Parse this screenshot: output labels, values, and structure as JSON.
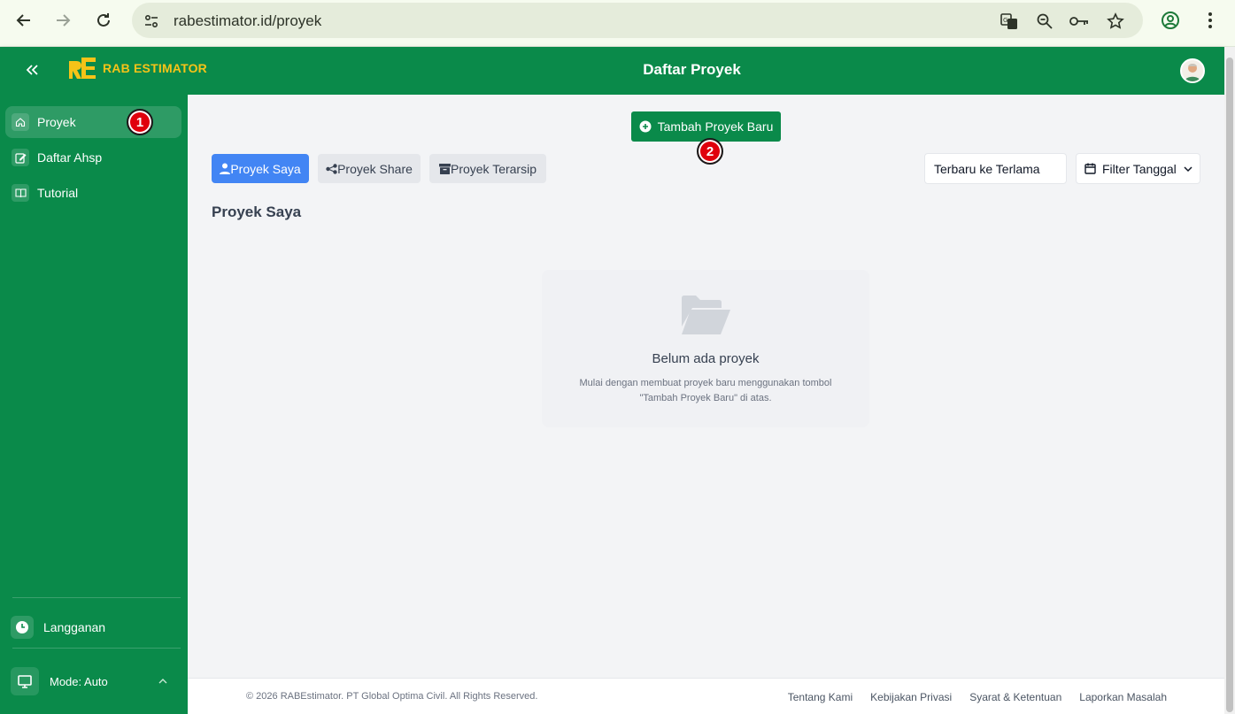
{
  "browser": {
    "url": "rabestimator.id/proyek"
  },
  "header": {
    "logo_text": "RAB ESTIMATOR",
    "title": "Daftar Proyek"
  },
  "sidebar": {
    "items": [
      {
        "label": "Proyek",
        "icon": "home-icon"
      },
      {
        "label": "Daftar Ahsp",
        "icon": "edit-icon"
      },
      {
        "label": "Tutorial",
        "icon": "book-icon"
      }
    ],
    "subscription_label": "Langganan",
    "mode_label": "Mode: Auto"
  },
  "badges": [
    "1",
    "2"
  ],
  "main": {
    "add_button_label": "Tambah Proyek Baru",
    "tabs": [
      {
        "label": "Proyek Saya",
        "icon": "user-icon"
      },
      {
        "label": "Proyek Share",
        "icon": "share-icon"
      },
      {
        "label": "Proyek Terarsip",
        "icon": "archive-icon"
      }
    ],
    "sort_value": "Terbaru ke Terlama",
    "filter_label": "Filter Tanggal",
    "section_title": "Proyek Saya",
    "empty_title": "Belum ada proyek",
    "empty_desc_line1": "Mulai dengan membuat proyek baru menggunakan tombol",
    "empty_desc_line2": "\"Tambah Proyek Baru\" di atas."
  },
  "footer": {
    "copyright": "© 2026 RABEstimator. PT Global Optima Civil. All Rights Reserved.",
    "links": [
      "Tentang Kami",
      "Kebijakan Privasi",
      "Syarat & Ketentuan",
      "Laporkan Masalah"
    ]
  },
  "colors": {
    "brand_green": "#0a8a4a",
    "logo_yellow": "#f6c318",
    "primary_blue": "#4285f4",
    "badge_red": "#e0000c"
  }
}
